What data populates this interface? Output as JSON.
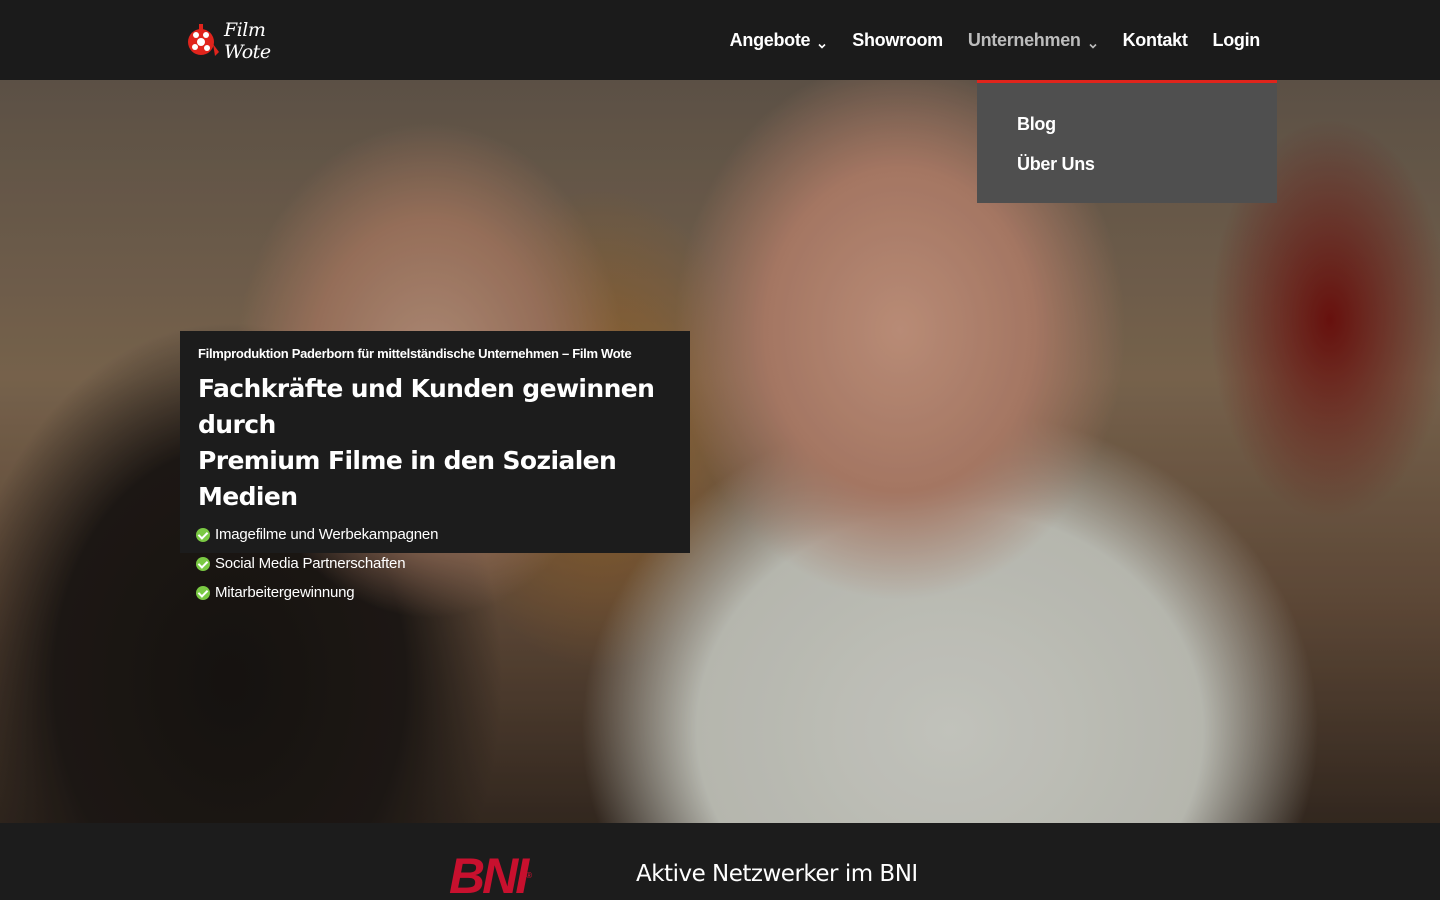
{
  "brand": {
    "name": "Film Wote",
    "accent": "#e0241c"
  },
  "nav": {
    "items": [
      {
        "label": "Angebote",
        "has_dropdown": true
      },
      {
        "label": "Showroom",
        "has_dropdown": false
      },
      {
        "label": "Unternehmen",
        "has_dropdown": true,
        "active": true
      },
      {
        "label": "Kontakt",
        "has_dropdown": false
      },
      {
        "label": "Login",
        "has_dropdown": false
      }
    ],
    "dropdown": {
      "items": [
        {
          "label": "Blog"
        },
        {
          "label": "Über Uns"
        }
      ]
    }
  },
  "hero": {
    "kicker": "Filmproduktion Paderborn für mittelständische Unternehmen – Film Wote",
    "title_line1": "Fachkräfte und Kunden gewinnen durch",
    "title_line2": "Premium Filme in den Sozialen Medien",
    "features": [
      "Imagefilme und Werbekampagnen",
      "Social Media Partnerschaften",
      "Mitarbeitergewinnung"
    ]
  },
  "bottom": {
    "logo_text": "BNI",
    "logo_mark": "®",
    "text": "Aktive Netzwerker im BNI"
  }
}
